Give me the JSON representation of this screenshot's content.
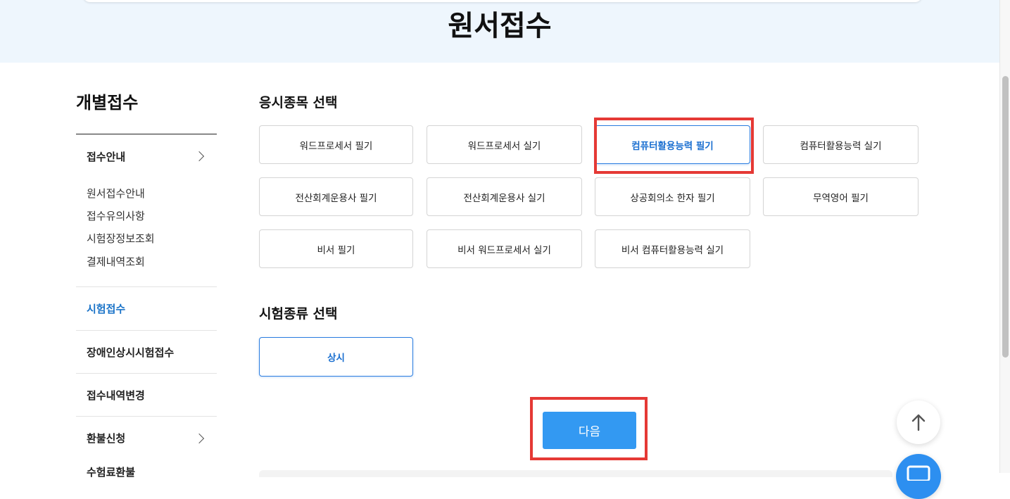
{
  "header": {
    "title": "원서접수"
  },
  "sidebar": {
    "title": "개별접수",
    "items": [
      {
        "label": "접수안내",
        "has_chevron": true
      },
      {
        "label": "시험접수",
        "active": true
      },
      {
        "label": "장애인상시시험접수"
      },
      {
        "label": "접수내역변경"
      },
      {
        "label": "환불신청",
        "has_chevron": true
      },
      {
        "label": "수험료환불"
      }
    ],
    "subitems": [
      "원서접수안내",
      "접수유의사항",
      "시험장정보조회",
      "결제내역조회"
    ]
  },
  "exam_subject": {
    "title": "응시종목 선택",
    "options": [
      {
        "label": "워드프로세서 필기"
      },
      {
        "label": "워드프로세서 실기"
      },
      {
        "label": "컴퓨터활용능력 필기",
        "selected": true
      },
      {
        "label": "컴퓨터활용능력 실기"
      },
      {
        "label": "전산회계운용사 필기"
      },
      {
        "label": "전산회계운용사 실기"
      },
      {
        "label": "상공회의소 한자 필기"
      },
      {
        "label": "무역영어 필기"
      },
      {
        "label": "비서 필기"
      },
      {
        "label": "비서 워드프로세서 실기"
      },
      {
        "label": "비서 컴퓨터활용능력 실기"
      }
    ]
  },
  "exam_type": {
    "title": "시험종류 선택",
    "options": [
      {
        "label": "상시",
        "selected": true
      }
    ]
  },
  "actions": {
    "next_label": "다음"
  },
  "icons": {
    "sidebar_chevron": "chevron-right-icon",
    "scroll_top": "arrow-up-icon",
    "chat": "chat-icon"
  },
  "colors": {
    "accent": "#2b7de0",
    "button_primary": "#3399f2",
    "highlight": "#e53935",
    "hero_bg": "#eef6fd"
  }
}
